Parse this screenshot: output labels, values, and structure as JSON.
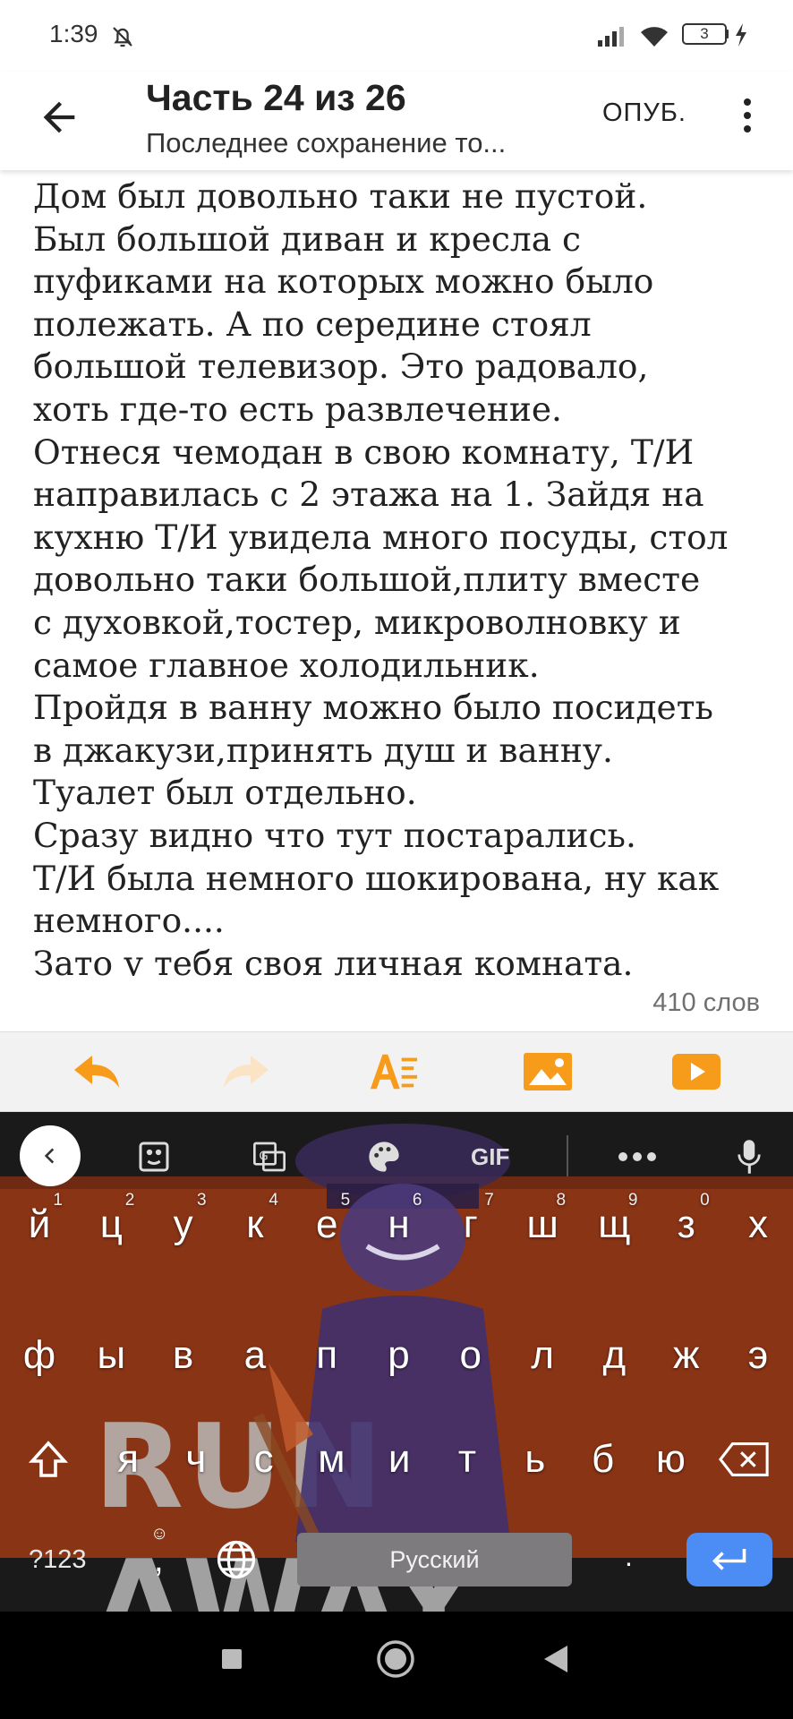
{
  "status_bar": {
    "time": "1:39",
    "battery_level": "3"
  },
  "app_bar": {
    "title": "Часть 24 из 26",
    "subtitle": "Последнее сохранение то...",
    "publish_label": "ОПУБ."
  },
  "editor": {
    "lines": [
      "Дом был довольно таки не пустой.",
      "Был большой диван и кресла с",
      "пуфиками на которых можно было",
      "полежать. А по середине стоял",
      "большой телевизор. Это радовало,",
      "хоть где-то есть развлечение.",
      "Отнеся чемодан в свою комнату, Т/И",
      "направилась с 2 этажа на 1. Зайдя на",
      "кухню Т/И увидела много посуды, стол",
      "довольно таки большой,плиту вместе",
      "с духовкой,тостер, микроволновку и",
      "самое главное холодильник.",
      "Пройдя в ванну можно было посидеть",
      "в джакузи,принять душ и ванну.",
      "Туалет был отдельно.",
      "Сразу видно что тут постарались.",
      "Т/И была немного шокирована, ну как",
      "немного....",
      "Зато у тебя своя личная комната."
    ],
    "word_count": "410 слов"
  },
  "keyboard": {
    "toolbar": {
      "gif_label": "GIF"
    },
    "row1": [
      {
        "key": "й",
        "hint": "1"
      },
      {
        "key": "ц",
        "hint": "2"
      },
      {
        "key": "у",
        "hint": "3"
      },
      {
        "key": "к",
        "hint": "4"
      },
      {
        "key": "е",
        "hint": "5"
      },
      {
        "key": "н",
        "hint": "6"
      },
      {
        "key": "г",
        "hint": "7"
      },
      {
        "key": "ш",
        "hint": "8"
      },
      {
        "key": "щ",
        "hint": "9"
      },
      {
        "key": "з",
        "hint": "0"
      },
      {
        "key": "х",
        "hint": ""
      }
    ],
    "row2": [
      "ф",
      "ы",
      "в",
      "а",
      "п",
      "р",
      "о",
      "л",
      "д",
      "ж",
      "э"
    ],
    "row3": [
      "я",
      "ч",
      "с",
      "м",
      "и",
      "т",
      "ь",
      "б",
      "ю"
    ],
    "num_key": "?123",
    "comma_key": ",",
    "space_label": "Русский",
    "period_key": ".",
    "watermark": "RUN AWAY"
  },
  "colors": {
    "accent_orange": "#f79b1b",
    "keyboard_bg": "#8a3416",
    "enter_blue": "#4b8df4"
  }
}
